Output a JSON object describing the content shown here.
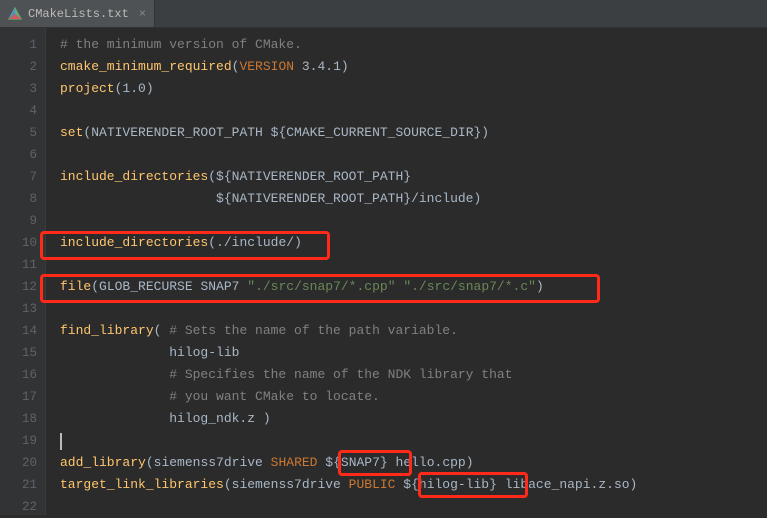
{
  "tab": {
    "filename": "CMakeLists.txt"
  },
  "lines": {
    "l1": {
      "c1": "# the minimum version of CMake."
    },
    "l2": {
      "f": "cmake_minimum_required",
      "p1": "(",
      "kw": "VERSION",
      "sp": " 3.4.1",
      "p2": ")"
    },
    "l3": {
      "f": "project",
      "p1": "(",
      "v": "1.0",
      "p2": ")"
    },
    "l5": {
      "f": "set",
      "p1": "(",
      "a1": "NATIVERENDER_ROOT_PATH ",
      "a2": "${CMAKE_CURRENT_SOURCE_DIR}",
      "p2": ")"
    },
    "l7": {
      "f": "include_directories",
      "p1": "(",
      "a1": "${NATIVERENDER_ROOT_PATH}"
    },
    "l8": {
      "indent": "                    ",
      "a1": "${NATIVERENDER_ROOT_PATH}",
      "a2": "/include",
      "p2": ")"
    },
    "l10": {
      "f": "include_directories",
      "p1": "(",
      "a1": "./include/",
      "p2": ")"
    },
    "l12": {
      "f": "file",
      "p1": "(",
      "a1": "GLOB_RECURSE SNAP7 ",
      "s1": "\"./src/snap7/*.cpp\"",
      "sp": " ",
      "s2": "\"./src/snap7/*.c\"",
      "p2": ")"
    },
    "l14": {
      "f": "find_library",
      "p1": "( ",
      "c": "# Sets the name of the path variable."
    },
    "l15": {
      "indent": "              ",
      "a": "hilog-lib"
    },
    "l16": {
      "indent": "              ",
      "c": "# Specifies the name of the NDK library that"
    },
    "l17": {
      "indent": "              ",
      "c": "# you want CMake to locate."
    },
    "l18": {
      "indent": "              ",
      "a": "hilog_ndk.z ",
      "p2": ")"
    },
    "l20": {
      "f": "add_library",
      "p1": "(",
      "a1": "siemenss7drive ",
      "kw": "SHARED",
      "sp": " ",
      "a2": "${SNAP7}",
      "a3": " hello.cpp",
      "p2": ")"
    },
    "l21": {
      "f": "target_link_libraries",
      "p1": "(",
      "a1": "siemenss7drive ",
      "kw": "PUBLIC",
      "sp": " ",
      "a2": "${hilog-lib}",
      "a3": " libace_napi.z.so",
      "p2": ")"
    }
  },
  "gutter": [
    "1",
    "2",
    "3",
    "4",
    "5",
    "6",
    "7",
    "8",
    "9",
    "10",
    "11",
    "12",
    "13",
    "14",
    "15",
    "16",
    "17",
    "18",
    "19",
    "20",
    "21",
    "22"
  ]
}
